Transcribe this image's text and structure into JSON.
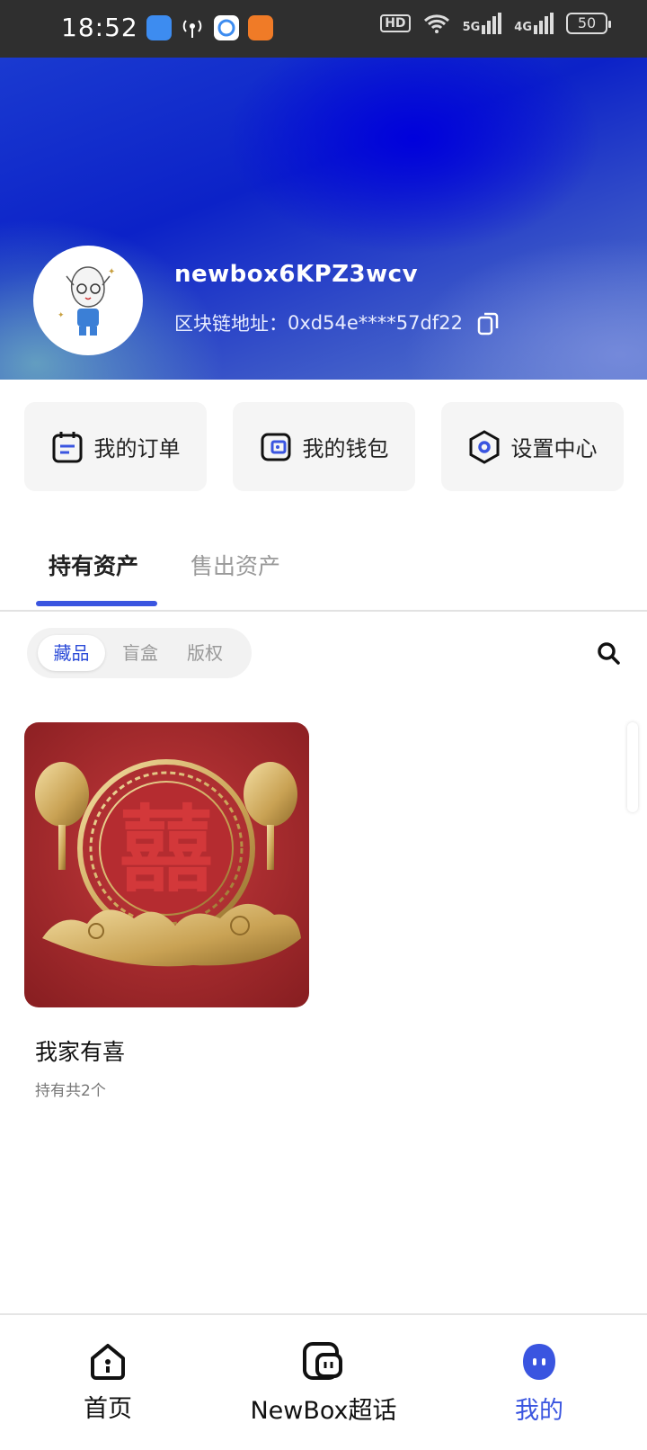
{
  "status_bar": {
    "time": "18:52",
    "hd_label": "HD",
    "net_5g": "5G",
    "net_4g": "4G",
    "battery": "50"
  },
  "profile": {
    "username": "newbox6KPZ3wcv",
    "address_label": "区块链地址：",
    "address_value": "0xd54e****57df22"
  },
  "quick_actions": [
    {
      "label": "我的订单",
      "icon": "order-icon"
    },
    {
      "label": "我的钱包",
      "icon": "wallet-icon"
    },
    {
      "label": "设置中心",
      "icon": "settings-icon"
    }
  ],
  "tabs": {
    "holding": "持有资产",
    "sold": "售出资产"
  },
  "subtabs": [
    "藏品",
    "盲盒",
    "版权"
  ],
  "items": [
    {
      "title": "我家有喜",
      "subtitle": "持有共2个"
    }
  ],
  "bottom_nav": [
    {
      "label": "首页",
      "icon": "home-icon"
    },
    {
      "label": "NewBox超话",
      "icon": "chat-icon"
    },
    {
      "label": "我的",
      "icon": "profile-icon"
    }
  ],
  "colors": {
    "accent": "#3a55e0",
    "header_blue": "#0c22c8",
    "card_red": "#a8272c",
    "gold": "#d7b86e"
  }
}
